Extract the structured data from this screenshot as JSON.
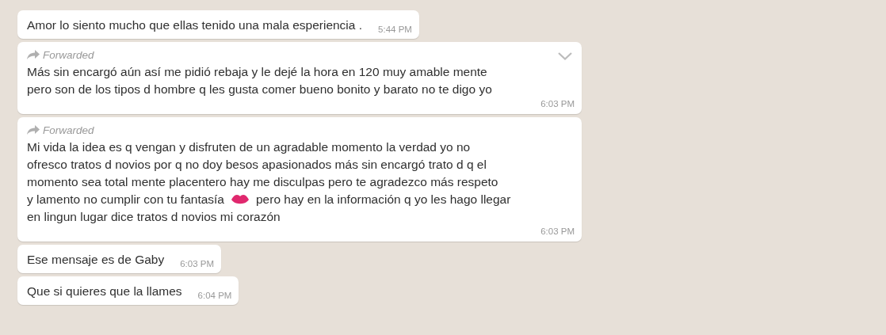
{
  "messages": [
    {
      "forwarded": false,
      "menu_chevron": false,
      "lines": [
        [
          {
            "kind": "text",
            "text": "Amor lo siento mucho que ellas tenido una mala esperiencia ."
          }
        ]
      ],
      "time": "5:44 PM"
    },
    {
      "forwarded": true,
      "forwarded_label": "Forwarded",
      "menu_chevron": true,
      "lines": [
        [
          {
            "kind": "text",
            "text": "Más sin encargó aún así me pidió rebaja y le dejé la hora en 120 muy amable mente"
          }
        ],
        [
          {
            "kind": "text",
            "text": "pero son de los tipos d hombre q les gusta comer bueno bonito y barato no te digo yo"
          }
        ]
      ],
      "time": "6:03 PM"
    },
    {
      "forwarded": true,
      "forwarded_label": "Forwarded",
      "menu_chevron": false,
      "lines": [
        [
          {
            "kind": "text",
            "text": "Mi vida la idea es q vengan y disfruten de un agradable momento la verdad yo no"
          }
        ],
        [
          {
            "kind": "text",
            "text": "ofresco tratos d novios por q no doy besos apasionados más sin encargó trato d q el"
          }
        ],
        [
          {
            "kind": "text",
            "text": "momento sea total mente placentero hay me disculpas pero te agradezco más respeto"
          }
        ],
        [
          {
            "kind": "text",
            "text": "y lamento no cumplir con tu fantasía"
          },
          {
            "kind": "kiss"
          },
          {
            "kind": "text",
            "text": "pero hay en la información q yo les hago llegar"
          }
        ],
        [
          {
            "kind": "text",
            "text": "en lingun lugar dice tratos d novios mi corazón"
          }
        ]
      ],
      "time": "6:03 PM"
    },
    {
      "forwarded": false,
      "menu_chevron": false,
      "lines": [
        [
          {
            "kind": "text",
            "text": "Ese mensaje es de Gaby"
          }
        ]
      ],
      "time": "6:03 PM"
    },
    {
      "forwarded": false,
      "menu_chevron": false,
      "lines": [
        [
          {
            "kind": "text",
            "text": "Que si quieres que la llames"
          }
        ]
      ],
      "time": "6:04 PM"
    }
  ]
}
